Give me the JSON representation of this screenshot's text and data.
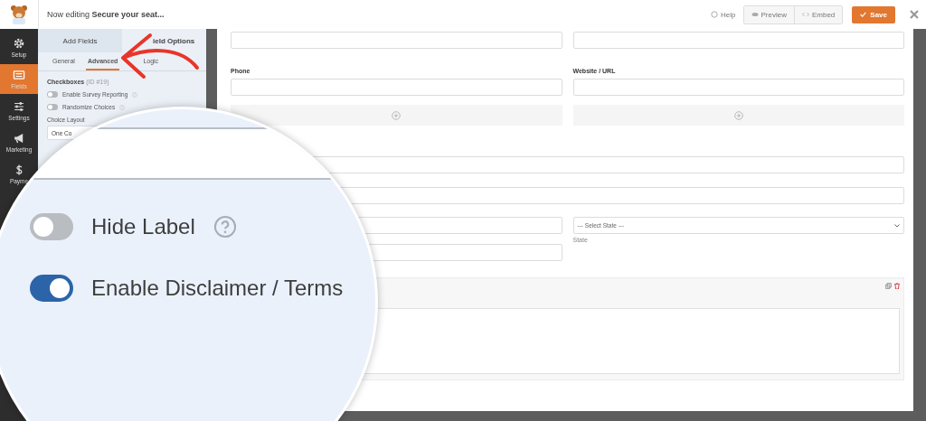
{
  "header": {
    "title": "Now editing **Secure your seat...**",
    "help": "Help",
    "preview": "Preview",
    "embed": "Embed",
    "save": "Save"
  },
  "sidebar": {
    "items": [
      {
        "label": "Setup",
        "kind": "gear",
        "selected": false
      },
      {
        "label": "Fields",
        "kind": "fields",
        "selected": true
      },
      {
        "label": "Settings",
        "kind": "sliders",
        "selected": false
      },
      {
        "label": "Marketing",
        "kind": "megaphone",
        "selected": false
      },
      {
        "label": "Payme",
        "kind": "dollar",
        "selected": false
      }
    ]
  },
  "panel": {
    "tabs": [
      {
        "label": "Add Fields",
        "selected": false
      },
      {
        "label": "ield Options",
        "selected": true
      }
    ],
    "subtabs": [
      {
        "label": "General",
        "selected": false
      },
      {
        "label": "Advanced",
        "selected": true
      },
      {
        "label": "Logic",
        "selected": false
      }
    ],
    "field_title": "Checkboxes",
    "field_id": "(ID #19)",
    "toggles": [
      {
        "label": "Enable Survey Reporting",
        "on": false,
        "help": true
      },
      {
        "label": "Randomize Choices",
        "on": false,
        "help": true
      }
    ],
    "choice_layout": {
      "label": "Choice Layout",
      "value": "One Co"
    }
  },
  "form": {
    "labels": [
      "Phone",
      "Website / URL"
    ],
    "state_select": {
      "value": "--- Select State ---",
      "sublabel": "State"
    }
  },
  "magnifier": {
    "toggles": [
      {
        "label": "Hide Label",
        "on": false,
        "help": true
      },
      {
        "label": "Enable Disclaimer / Terms",
        "on": true,
        "help": false
      }
    ]
  }
}
